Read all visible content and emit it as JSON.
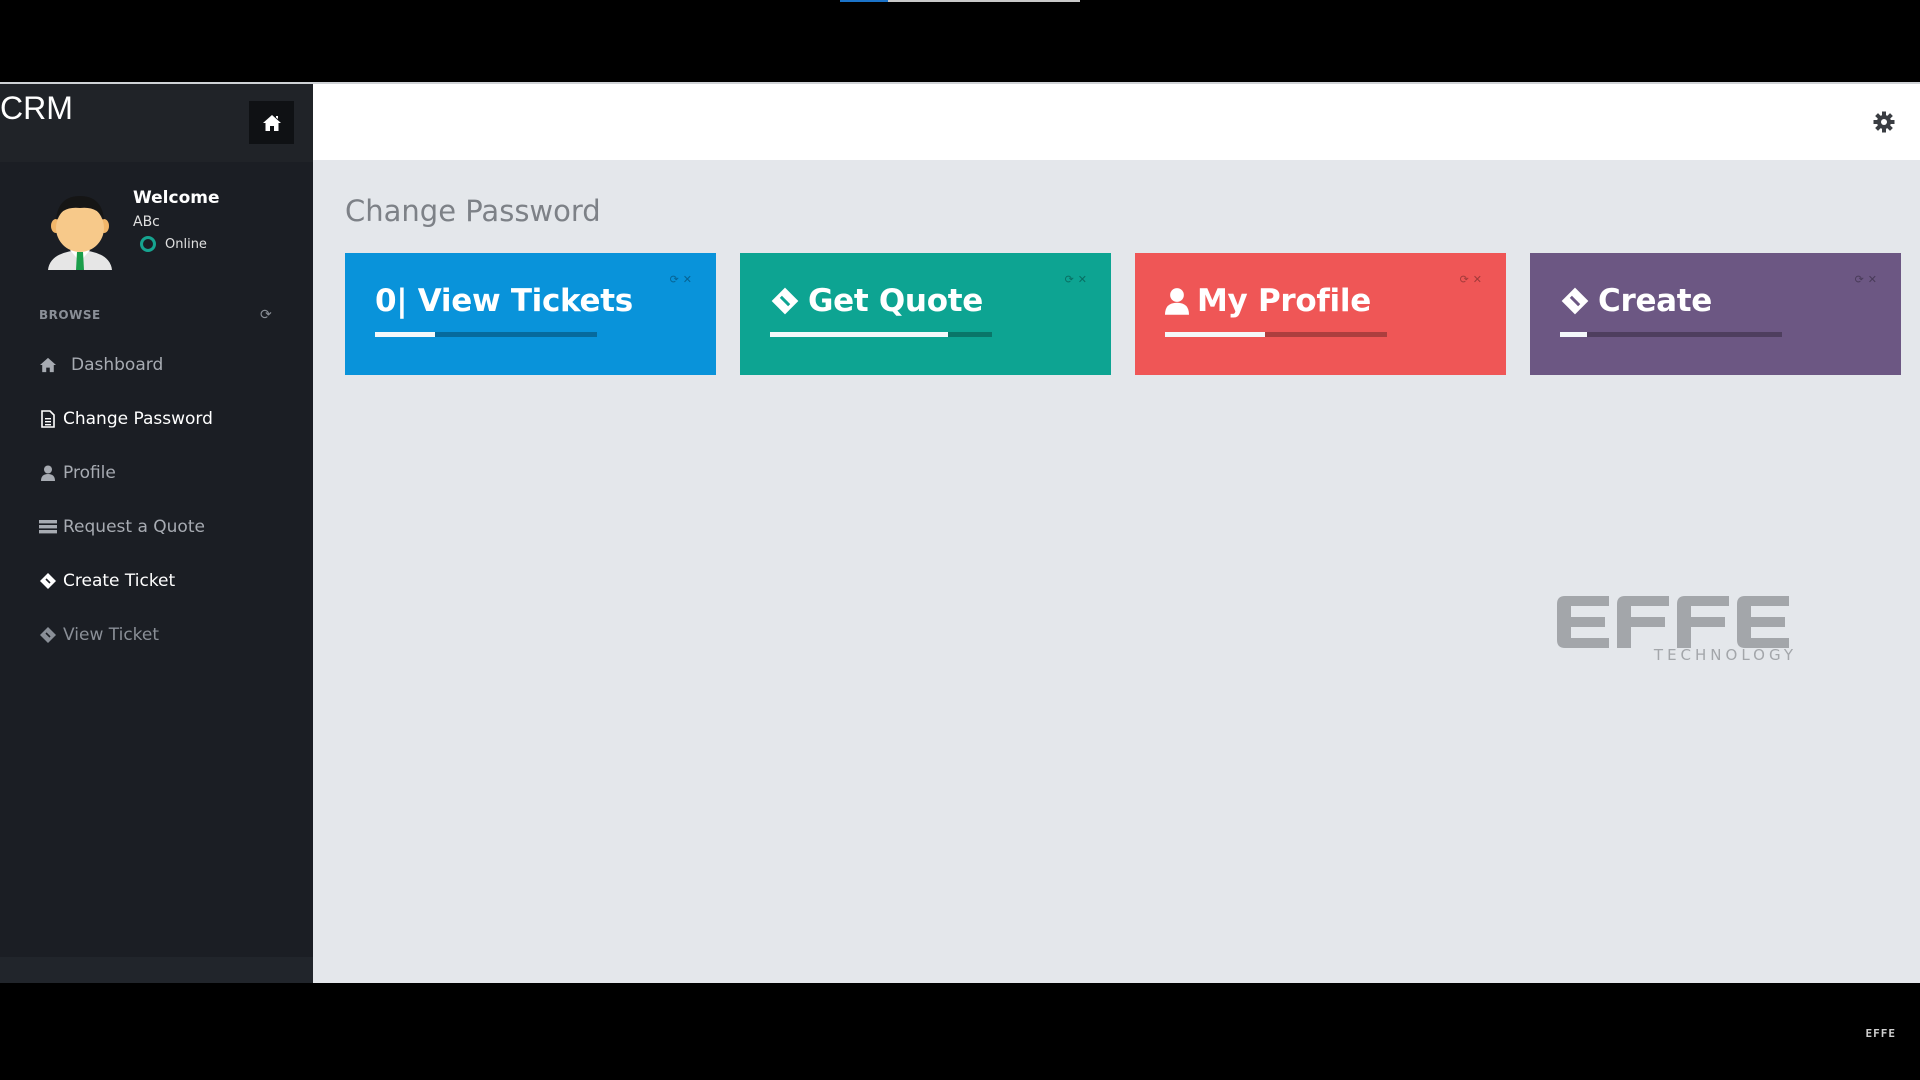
{
  "window": {
    "tab_active_color": "#1b73c9"
  },
  "sidebar": {
    "brand": "CRM",
    "home_icon": "home-icon",
    "welcome": "Welcome",
    "user_name": "ABc",
    "status": "Online",
    "status_color": "#16a490",
    "browse_label": "BROWSE",
    "items": [
      {
        "label": "Dashboard",
        "icon": "home-icon",
        "state": "normal"
      },
      {
        "label": "Change Password",
        "icon": "file-text-icon",
        "state": "active"
      },
      {
        "label": "Profile",
        "icon": "user-icon",
        "state": "normal"
      },
      {
        "label": "Request a Quote",
        "icon": "list-icon",
        "state": "normal"
      },
      {
        "label": "Create Ticket",
        "icon": "ticket-icon",
        "state": "active"
      },
      {
        "label": "View Ticket",
        "icon": "ticket-icon",
        "state": "dim"
      }
    ]
  },
  "header": {
    "settings_icon": "gear-icon"
  },
  "main": {
    "page_title": "Change Password",
    "tiles": [
      {
        "label": "0| View Tickets",
        "icon": "none",
        "color": "#0993da",
        "progress": 0.27
      },
      {
        "label": "Get Quote",
        "icon": "ticket-icon",
        "color": "#0da492",
        "progress": 0.8
      },
      {
        "label": "My Profile",
        "icon": "user-icon",
        "color": "#ef5656",
        "progress": 0.45
      },
      {
        "label": "Create",
        "icon": "ticket-icon",
        "color": "#6c5783",
        "progress": 0.12
      }
    ],
    "tile_controls": {
      "refresh": "⟳",
      "close": "✕"
    }
  },
  "watermark": {
    "brand": "EFFE",
    "tagline": "TECHNOLOGY"
  },
  "footer": {
    "logo": "EFFE"
  }
}
